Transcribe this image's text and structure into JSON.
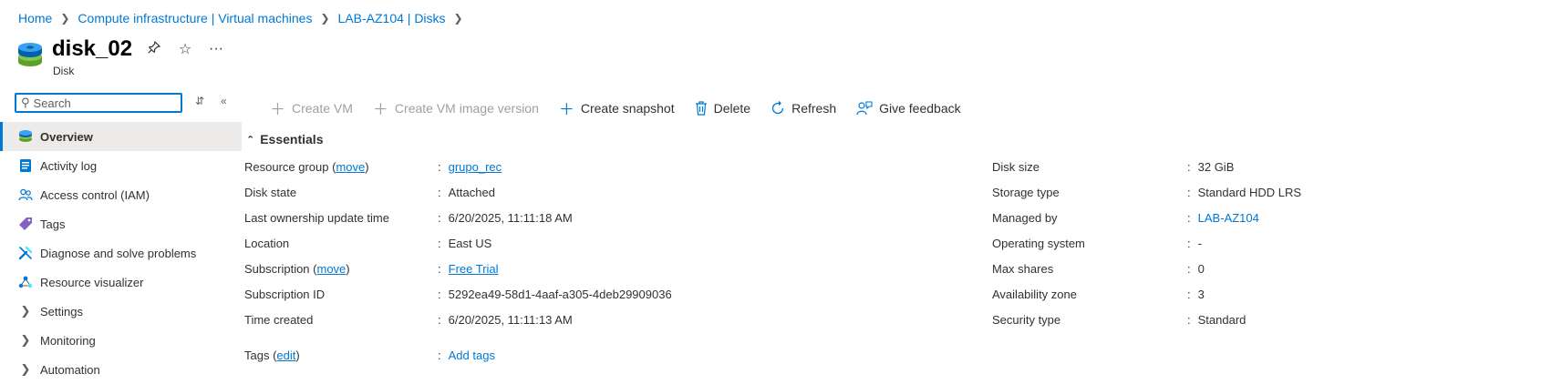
{
  "breadcrumb": [
    "Home",
    "Compute infrastructure | Virtual machines",
    "LAB-AZ104 | Disks"
  ],
  "header": {
    "title": "disk_02",
    "subtitle": "Disk"
  },
  "search": {
    "placeholder": "Search",
    "value": ""
  },
  "nav": {
    "items": [
      {
        "label": "Overview",
        "icon": "disk-icon"
      },
      {
        "label": "Activity log",
        "icon": "activity-log-icon"
      },
      {
        "label": "Access control (IAM)",
        "icon": "people-icon"
      },
      {
        "label": "Tags",
        "icon": "tag-icon"
      },
      {
        "label": "Diagnose and solve problems",
        "icon": "wrench-icon"
      },
      {
        "label": "Resource visualizer",
        "icon": "visualizer-icon"
      }
    ],
    "groups": [
      "Settings",
      "Monitoring",
      "Automation"
    ]
  },
  "toolbar": {
    "create_vm": "Create VM",
    "create_vm_image": "Create VM image version",
    "create_snapshot": "Create snapshot",
    "delete": "Delete",
    "refresh": "Refresh",
    "feedback": "Give feedback"
  },
  "essentials": {
    "header": "Essentials",
    "move": "move",
    "left": [
      {
        "label": "Resource group (",
        "value": "grupo_rec"
      },
      {
        "label": "Disk state",
        "value": "Attached"
      },
      {
        "label": "Last ownership update time",
        "value": "6/20/2025, 11:11:18 AM"
      },
      {
        "label": "Location",
        "value": "East US"
      },
      {
        "label": "Subscription (",
        "value": "Free Trial"
      },
      {
        "label": "Subscription ID",
        "value": "5292ea49-58d1-4aaf-a305-4deb29909036"
      },
      {
        "label": "Time created",
        "value": "6/20/2025, 11:11:13 AM"
      }
    ],
    "right": [
      {
        "label": "Disk size",
        "value": "32 GiB"
      },
      {
        "label": "Storage type",
        "value": "Standard HDD LRS"
      },
      {
        "label": "Managed by",
        "value": "LAB-AZ104"
      },
      {
        "label": "Operating system",
        "value": "-"
      },
      {
        "label": "Max shares",
        "value": "0"
      },
      {
        "label": "Availability zone",
        "value": "3"
      },
      {
        "label": "Security type",
        "value": "Standard"
      }
    ],
    "tags_label": "Tags (",
    "tags_edit": "edit",
    "tags_close": ")",
    "add_tags": "Add tags",
    "colon": ":"
  }
}
